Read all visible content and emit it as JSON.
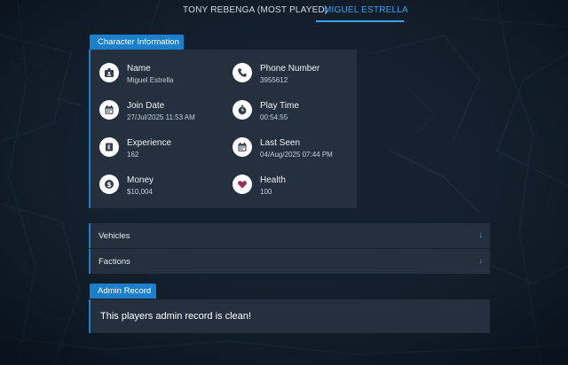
{
  "tabs": [
    {
      "label": "TONY REBENGA (MOST PLAYED)",
      "active": false
    },
    {
      "label": "MIGUEL ESTRELLA",
      "active": true
    }
  ],
  "character_info": {
    "title": "Character Information",
    "items": [
      {
        "icon": "id-card-icon",
        "label": "Name",
        "value": "Miguel Estrella"
      },
      {
        "icon": "phone-icon",
        "label": "Phone Number",
        "value": "3955612"
      },
      {
        "icon": "calendar-icon",
        "label": "Join Date",
        "value": "27/Jul/2025 11:53 AM"
      },
      {
        "icon": "stopwatch-icon",
        "label": "Play Time",
        "value": "00:54:55"
      },
      {
        "icon": "experience-icon",
        "label": "Experience",
        "value": "162"
      },
      {
        "icon": "calendar-icon",
        "label": "Last Seen",
        "value": "04/Aug/2025 07:44 PM"
      },
      {
        "icon": "dollar-icon",
        "label": "Money",
        "value": "$10,004"
      },
      {
        "icon": "heart-icon",
        "label": "Health",
        "value": "100"
      }
    ]
  },
  "accordions": [
    {
      "title": "Vehicles",
      "arrow": "↓"
    },
    {
      "title": "Factions",
      "arrow": "↓"
    }
  ],
  "admin_record": {
    "title": "Admin Record",
    "text": "This players admin record is clean!"
  },
  "colors": {
    "accent": "#1c7fcb",
    "active_tab": "#3aa4ee",
    "icon_dark": "#2f3d4c",
    "heart": "#9b2d5d",
    "panel": "#263240",
    "background": "#111b26"
  }
}
